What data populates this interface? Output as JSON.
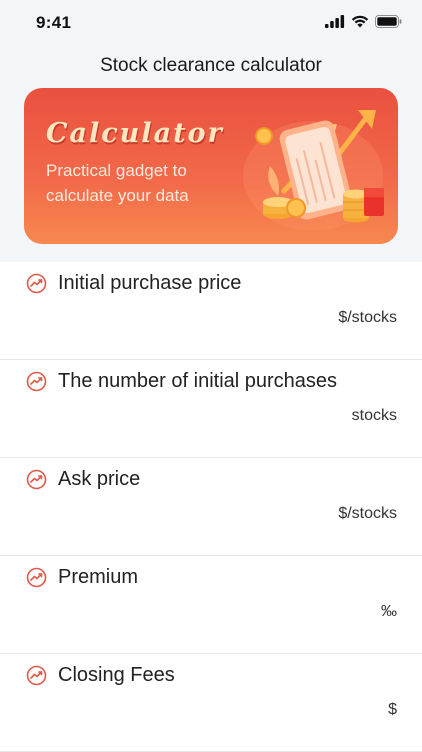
{
  "status_bar": {
    "time": "9:41"
  },
  "header": {
    "title": "Stock clearance calculator"
  },
  "banner": {
    "heading": "Calculator",
    "subtitle": "Practical gadget to calculate your data"
  },
  "colors": {
    "accent": "#e9503f",
    "icon": "#e05a4a"
  },
  "fields": [
    {
      "label": "Initial purchase price",
      "unit": "$/stocks",
      "value": ""
    },
    {
      "label": "The number of initial purchases",
      "unit": "stocks",
      "value": ""
    },
    {
      "label": "Ask price",
      "unit": "$/stocks",
      "value": ""
    },
    {
      "label": "Premium",
      "unit": "‰",
      "value": ""
    },
    {
      "label": "Closing Fees",
      "unit": "$",
      "value": ""
    }
  ]
}
